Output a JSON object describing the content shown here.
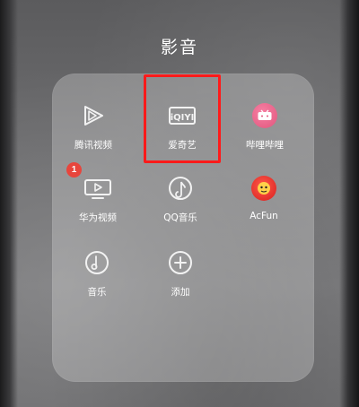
{
  "folder": {
    "title": "影音",
    "apps": [
      {
        "label": "腾讯视频",
        "icon": "tencent-video-icon"
      },
      {
        "label": "爱奇艺",
        "icon": "iqiyi-icon",
        "highlighted": true
      },
      {
        "label": "哔哩哔哩",
        "icon": "bilibili-icon"
      },
      {
        "label": "华为视频",
        "icon": "huawei-video-icon",
        "badge": "1"
      },
      {
        "label": "QQ音乐",
        "icon": "qq-music-icon"
      },
      {
        "label": "AcFun",
        "icon": "acfun-icon"
      },
      {
        "label": "音乐",
        "icon": "music-icon"
      },
      {
        "label": "添加",
        "icon": "add-icon"
      }
    ]
  },
  "colors": {
    "highlight": "#ff1a1a",
    "badge": "#e8453c",
    "bilibili": "#f0668f",
    "acfun": "#e52d2d"
  }
}
